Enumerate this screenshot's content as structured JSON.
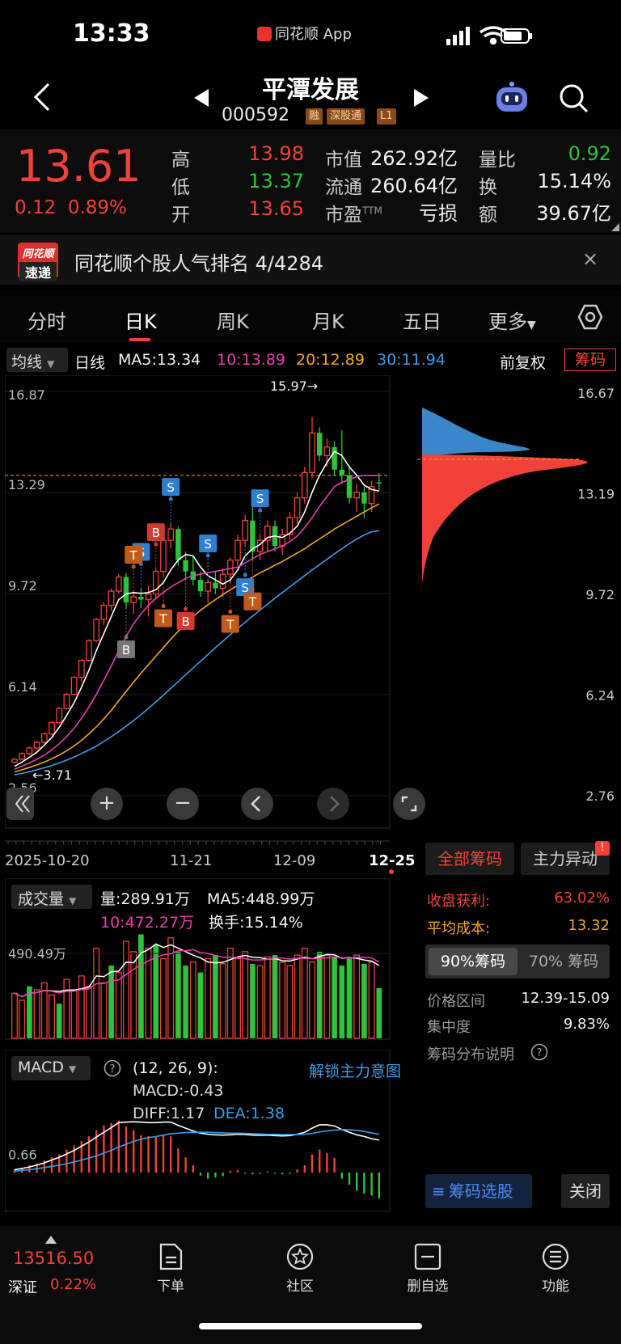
{
  "status_bar": {
    "time": "13:33",
    "source_app": "同花顺 App"
  },
  "header": {
    "stock_name": "平潭发展",
    "stock_code": "000592",
    "tags": [
      "融",
      "深股通",
      "L1"
    ]
  },
  "quote": {
    "price": "13.61",
    "change": "0.12",
    "change_pct": "0.89%",
    "high_label": "高",
    "high": "13.98",
    "low_label": "低",
    "low": "13.37",
    "open_label": "开",
    "open": "13.65",
    "mktcap_label": "市值",
    "mktcap": "262.92亿",
    "float_label": "流通",
    "float": "260.64亿",
    "pe_label": "市盈",
    "pe_sup": "TTM",
    "pe": "亏损",
    "vol_ratio_label": "量比",
    "vol_ratio": "0.92",
    "turnover_label": "换",
    "turnover": "15.14%",
    "amount_label": "额",
    "amount": "39.67亿"
  },
  "banner": {
    "logo_line1": "同花顺",
    "logo_line2": "速递",
    "text": "同花顺个股人气排名 4/4284",
    "close": "×"
  },
  "tabs": [
    "分时",
    "日K",
    "周K",
    "月K",
    "五日",
    "更多"
  ],
  "ma_line": {
    "selector": "均线",
    "period": "日线",
    "ma5": "MA5:13.34",
    "ma10": "10:13.89",
    "ma20": "20:12.89",
    "ma30": "30:11.94",
    "adjust": "前复权",
    "chip": "筹码"
  },
  "chart_data": {
    "type": "candlestick",
    "y_ticks": [
      "16.87",
      "13.29",
      "9.72",
      "6.14",
      "2.56"
    ],
    "ylim": [
      2.56,
      16.87
    ],
    "x_dates": [
      "2025-10-20",
      "11-21",
      "12-09",
      "12-25"
    ],
    "max_label": "15.97→",
    "min_label": "←3.71",
    "last_price_line": 13.61,
    "candles": [
      [
        3.75,
        3.9,
        3.71,
        3.85
      ],
      [
        3.85,
        4.1,
        3.82,
        4.05
      ],
      [
        4.05,
        4.3,
        4.0,
        4.25
      ],
      [
        4.25,
        4.5,
        4.2,
        4.45
      ],
      [
        4.45,
        4.8,
        4.4,
        4.75
      ],
      [
        4.75,
        5.2,
        4.7,
        5.15
      ],
      [
        5.15,
        5.7,
        5.1,
        5.65
      ],
      [
        5.65,
        6.2,
        5.6,
        6.15
      ],
      [
        6.15,
        6.8,
        6.1,
        6.75
      ],
      [
        6.75,
        7.4,
        6.6,
        7.35
      ],
      [
        7.35,
        8.1,
        7.3,
        8.05
      ],
      [
        8.05,
        8.85,
        8.0,
        8.8
      ],
      [
        8.8,
        9.4,
        8.6,
        9.3
      ],
      [
        9.3,
        9.9,
        9.1,
        9.8
      ],
      [
        9.8,
        10.4,
        9.7,
        10.3
      ],
      [
        10.3,
        10.45,
        9.2,
        9.4
      ],
      [
        9.4,
        9.8,
        9.0,
        9.6
      ],
      [
        9.6,
        9.9,
        9.2,
        9.5
      ],
      [
        9.5,
        10.0,
        8.9,
        9.7
      ],
      [
        9.7,
        10.6,
        9.5,
        10.5
      ],
      [
        10.5,
        11.8,
        10.3,
        11.6
      ],
      [
        11.6,
        12.2,
        11.3,
        12.0
      ],
      [
        12.0,
        12.1,
        10.7,
        10.9
      ],
      [
        10.9,
        11.2,
        10.2,
        10.5
      ],
      [
        10.5,
        11.0,
        10.0,
        10.2
      ],
      [
        10.2,
        10.5,
        9.6,
        9.8
      ],
      [
        9.8,
        10.2,
        9.4,
        10.1
      ],
      [
        10.1,
        10.5,
        9.7,
        9.9
      ],
      [
        9.9,
        10.6,
        9.6,
        10.4
      ],
      [
        10.4,
        11.0,
        10.1,
        10.9
      ],
      [
        10.9,
        11.8,
        10.7,
        11.6
      ],
      [
        11.6,
        12.5,
        11.4,
        12.3
      ],
      [
        12.3,
        12.8,
        10.9,
        11.2
      ],
      [
        11.2,
        11.8,
        10.9,
        11.6
      ],
      [
        11.6,
        12.3,
        11.2,
        12.1
      ],
      [
        12.1,
        12.3,
        11.2,
        11.4
      ],
      [
        11.4,
        12.0,
        11.1,
        11.8
      ],
      [
        11.8,
        12.6,
        11.6,
        12.4
      ],
      [
        12.4,
        13.3,
        12.2,
        13.1
      ],
      [
        13.1,
        14.2,
        12.9,
        14.0
      ],
      [
        14.0,
        15.97,
        13.8,
        15.4
      ],
      [
        15.4,
        15.6,
        14.4,
        14.6
      ],
      [
        14.6,
        15.2,
        14.2,
        14.9
      ],
      [
        14.9,
        15.1,
        13.9,
        14.1
      ],
      [
        14.1,
        15.5,
        13.6,
        13.9
      ],
      [
        13.9,
        14.2,
        12.9,
        13.1
      ],
      [
        13.1,
        13.6,
        12.6,
        13.3
      ],
      [
        13.3,
        13.5,
        12.4,
        12.9
      ],
      [
        12.9,
        13.7,
        12.6,
        13.5
      ],
      [
        13.65,
        13.98,
        13.37,
        13.61
      ]
    ],
    "ma5": [
      3.6,
      3.75,
      3.92,
      4.1,
      4.35,
      4.62,
      4.98,
      5.4,
      5.85,
      6.4,
      7.0,
      7.7,
      8.3,
      8.9,
      9.5,
      9.7,
      9.75,
      9.72,
      9.75,
      9.85,
      10.1,
      10.55,
      10.9,
      11.1,
      11.05,
      10.65,
      10.35,
      10.2,
      10.05,
      10.2,
      10.55,
      11.05,
      11.3,
      11.45,
      11.7,
      11.75,
      11.7,
      11.85,
      12.1,
      12.6,
      13.3,
      13.9,
      14.35,
      14.75,
      14.6,
      14.2,
      13.9,
      13.55,
      13.4,
      13.34
    ],
    "ma10": [
      3.5,
      3.6,
      3.72,
      3.85,
      4.0,
      4.18,
      4.4,
      4.65,
      4.95,
      5.3,
      5.7,
      6.15,
      6.65,
      7.15,
      7.7,
      8.2,
      8.65,
      9.0,
      9.3,
      9.55,
      9.75,
      9.95,
      10.1,
      10.25,
      10.35,
      10.4,
      10.45,
      10.5,
      10.55,
      10.6,
      10.65,
      10.8,
      10.95,
      11.1,
      11.2,
      11.3,
      11.4,
      11.55,
      11.75,
      12.05,
      12.4,
      12.8,
      13.15,
      13.5,
      13.65,
      13.75,
      13.85,
      13.9,
      13.9,
      13.89
    ],
    "ma20": [
      3.4,
      3.48,
      3.56,
      3.65,
      3.75,
      3.87,
      4.0,
      4.15,
      4.32,
      4.52,
      4.75,
      5.0,
      5.28,
      5.58,
      5.92,
      6.25,
      6.58,
      6.9,
      7.2,
      7.5,
      7.8,
      8.1,
      8.38,
      8.65,
      8.9,
      9.12,
      9.32,
      9.5,
      9.68,
      9.85,
      10.0,
      10.15,
      10.3,
      10.45,
      10.58,
      10.72,
      10.85,
      11.0,
      11.15,
      11.3,
      11.48,
      11.65,
      11.82,
      12.0,
      12.15,
      12.3,
      12.45,
      12.6,
      12.75,
      12.89
    ],
    "ma30": [
      3.3,
      3.35,
      3.41,
      3.48,
      3.55,
      3.63,
      3.72,
      3.82,
      3.93,
      4.05,
      4.18,
      4.32,
      4.48,
      4.65,
      4.83,
      5.02,
      5.22,
      5.43,
      5.65,
      5.88,
      6.12,
      6.36,
      6.6,
      6.84,
      7.08,
      7.32,
      7.56,
      7.8,
      8.03,
      8.26,
      8.48,
      8.7,
      8.92,
      9.13,
      9.34,
      9.55,
      9.75,
      9.95,
      10.15,
      10.35,
      10.55,
      10.74,
      10.93,
      11.12,
      11.3,
      11.48,
      11.64,
      11.79,
      11.9,
      11.94
    ],
    "signals": [
      {
        "i": 17,
        "label": "S",
        "kind": "sell",
        "pos": "above"
      },
      {
        "i": 16,
        "label": "T",
        "kind": "t",
        "pos": "above"
      },
      {
        "i": 19,
        "label": "B",
        "kind": "buy",
        "pos": "above"
      },
      {
        "i": 21,
        "label": "S",
        "kind": "sell",
        "pos": "above"
      },
      {
        "i": 15,
        "label": "B",
        "kind": "buybox",
        "pos": "below"
      },
      {
        "i": 20,
        "label": "T",
        "kind": "t",
        "pos": "below"
      },
      {
        "i": 23,
        "label": "B",
        "kind": "buy",
        "pos": "below"
      },
      {
        "i": 26,
        "label": "S",
        "kind": "sell",
        "pos": "above"
      },
      {
        "i": 29,
        "label": "T",
        "kind": "t",
        "pos": "below"
      },
      {
        "i": 31,
        "label": "S",
        "kind": "sell",
        "pos": "below"
      },
      {
        "i": 32,
        "label": "T",
        "kind": "t",
        "pos": "below"
      },
      {
        "i": 33,
        "label": "S",
        "kind": "sell",
        "pos": "above"
      }
    ],
    "chip_ticks": [
      "16.67",
      "13.19",
      "9.72",
      "6.24",
      "2.76"
    ]
  },
  "chart_controls": {
    "zoom_in": "+",
    "zoom_out": "−"
  },
  "chip_panel": {
    "all_chips": "全部筹码",
    "main_move": "主力异动",
    "badge": "!",
    "profit_label": "收盘获利:",
    "profit": "63.02%",
    "avg_cost_label": "平均成本:",
    "avg_cost": "13.32",
    "pct90": "90%筹码",
    "pct70": "70% 筹码",
    "range_label": "价格区间",
    "range": "12.39-15.09",
    "concentration_label": "集中度",
    "concentration": "9.83%",
    "explain_label": "筹码分布说明",
    "select_btn": "筹码选股",
    "close_btn": "关闭"
  },
  "volume": {
    "selector": "成交量",
    "vol": "量:289.91万",
    "ma5": "MA5:448.99万",
    "ma10": "10:472.27万",
    "turnover": "换手:15.14%",
    "y_tick": "490.49万",
    "bars": [
      260,
      220,
      300,
      280,
      320,
      250,
      200,
      340,
      280,
      360,
      300,
      520,
      320,
      420,
      380,
      560,
      500,
      600,
      520,
      540,
      460,
      580,
      500,
      420,
      440,
      380,
      460,
      480,
      430,
      520,
      460,
      500,
      430,
      420,
      470,
      480,
      440,
      420,
      480,
      520,
      440,
      500,
      480,
      470,
      420,
      460,
      480,
      430,
      440,
      290
    ],
    "colors": [
      "r",
      "r",
      "g",
      "r",
      "r",
      "r",
      "g",
      "r",
      "r",
      "r",
      "r",
      "r",
      "r",
      "g",
      "r",
      "r",
      "r",
      "g",
      "r",
      "g",
      "r",
      "r",
      "g",
      "g",
      "r",
      "g",
      "r",
      "g",
      "r",
      "r",
      "r",
      "r",
      "g",
      "r",
      "r",
      "g",
      "r",
      "r",
      "r",
      "r",
      "r",
      "g",
      "r",
      "g",
      "g",
      "g",
      "r",
      "g",
      "r",
      "g"
    ]
  },
  "macd": {
    "selector": "MACD",
    "params": "(12, 26, 9):",
    "macd": "MACD:-0.43",
    "diff": "DIFF:1.17",
    "dea": "DEA:1.38",
    "unlock": "解锁主力意图",
    "y_tick": "0.66",
    "hist": [
      0.05,
      0.08,
      0.12,
      0.15,
      0.2,
      0.25,
      0.3,
      0.38,
      0.45,
      0.52,
      0.6,
      0.7,
      0.78,
      0.82,
      0.86,
      0.76,
      0.7,
      0.62,
      0.6,
      0.6,
      0.62,
      0.6,
      0.4,
      0.25,
      0.12,
      -0.05,
      -0.1,
      -0.08,
      -0.06,
      0.03,
      0.04,
      -0.02,
      -0.03,
      -0.02,
      0.02,
      -0.02,
      -0.03,
      -0.02,
      0.05,
      0.12,
      0.3,
      0.38,
      0.32,
      0.24,
      -0.1,
      -0.2,
      -0.3,
      -0.35,
      -0.38,
      -0.43
    ],
    "diff_line": [
      0.1,
      0.15,
      0.2,
      0.27,
      0.35,
      0.45,
      0.55,
      0.67,
      0.8,
      0.95,
      1.1,
      1.28,
      1.45,
      1.62,
      1.8,
      1.82,
      1.83,
      1.82,
      1.8,
      1.8,
      1.82,
      1.82,
      1.7,
      1.6,
      1.5,
      1.42,
      1.38,
      1.36,
      1.35,
      1.36,
      1.38,
      1.37,
      1.35,
      1.34,
      1.35,
      1.33,
      1.32,
      1.33,
      1.38,
      1.45,
      1.6,
      1.72,
      1.72,
      1.68,
      1.55,
      1.45,
      1.36,
      1.3,
      1.22,
      1.17
    ],
    "dea_line": [
      0.05,
      0.08,
      0.1,
      0.14,
      0.18,
      0.22,
      0.27,
      0.32,
      0.38,
      0.45,
      0.52,
      0.6,
      0.7,
      0.8,
      0.92,
      1.02,
      1.12,
      1.2,
      1.26,
      1.3,
      1.35,
      1.4,
      1.42,
      1.44,
      1.45,
      1.45,
      1.45,
      1.44,
      1.43,
      1.42,
      1.42,
      1.41,
      1.4,
      1.39,
      1.38,
      1.38,
      1.37,
      1.37,
      1.37,
      1.38,
      1.41,
      1.46,
      1.5,
      1.53,
      1.55,
      1.54,
      1.52,
      1.48,
      1.43,
      1.38
    ]
  },
  "bottom_nav": {
    "index_value": "13516.50",
    "index_name": "深证",
    "index_change": "0.22%",
    "items": [
      "下单",
      "社区",
      "删自选",
      "功能"
    ]
  },
  "colors": {
    "up": "#f04238",
    "down": "#2ec33d",
    "ma5": "#ffffff",
    "ma10": "#e83fb0",
    "ma20": "#f5a623",
    "ma30": "#3a9ee8"
  }
}
